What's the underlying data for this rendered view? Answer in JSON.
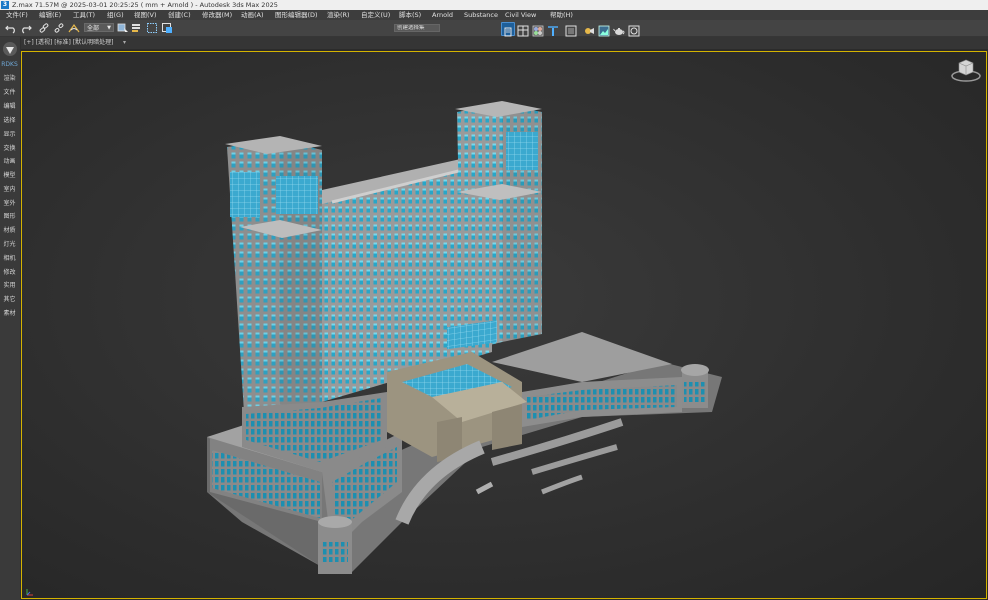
{
  "window": {
    "app_icon": "3",
    "title": "Z.max  71.57M @ 2025-03-01 20:25:25  ( mm + Arnold ) - Autodesk 3ds Max 2025"
  },
  "menu": {
    "items": [
      {
        "label": "文件(F)"
      },
      {
        "label": "编辑(E)"
      },
      {
        "label": "工具(T)"
      },
      {
        "label": "组(G)"
      },
      {
        "label": "视图(V)"
      },
      {
        "label": "创建(C)"
      },
      {
        "label": "修改器(M)"
      },
      {
        "label": "动画(A)"
      },
      {
        "label": "图形编辑器(D)"
      },
      {
        "label": "渲染(R)"
      },
      {
        "label": "自定义(U)"
      },
      {
        "label": "脚本(S)"
      },
      {
        "label": "Arnold"
      },
      {
        "label": "Substance"
      },
      {
        "label": "Civil View"
      },
      {
        "label": "帮助(H)"
      }
    ]
  },
  "toolbar": {
    "selection_filter": "全部",
    "named_selection_placeholder": "创建选择集",
    "icons": {
      "undo": "undo-icon",
      "redo": "redo-icon",
      "link": "link-icon",
      "unlink": "unlink-icon",
      "bind": "bind-space-warp-icon"
    },
    "accent": "#1c79c7"
  },
  "sidebar": {
    "header": "RDKS",
    "items": [
      {
        "label": "渲染"
      },
      {
        "label": "文件"
      },
      {
        "label": "编辑"
      },
      {
        "label": "选择"
      },
      {
        "label": "显示"
      },
      {
        "label": "交换"
      },
      {
        "label": "动画"
      },
      {
        "label": "模型"
      },
      {
        "label": "室内"
      },
      {
        "label": "室外"
      },
      {
        "label": "图形"
      },
      {
        "label": "材质"
      },
      {
        "label": "灯光"
      },
      {
        "label": "相机"
      },
      {
        "label": "修改"
      },
      {
        "label": "实用"
      },
      {
        "label": "其它"
      },
      {
        "label": "素材"
      }
    ]
  },
  "viewport": {
    "label": "[+] [透视] [标准] [默认明暗处理]",
    "extra": "▾",
    "active_border_color": "#d4b300",
    "model": "building-model"
  }
}
